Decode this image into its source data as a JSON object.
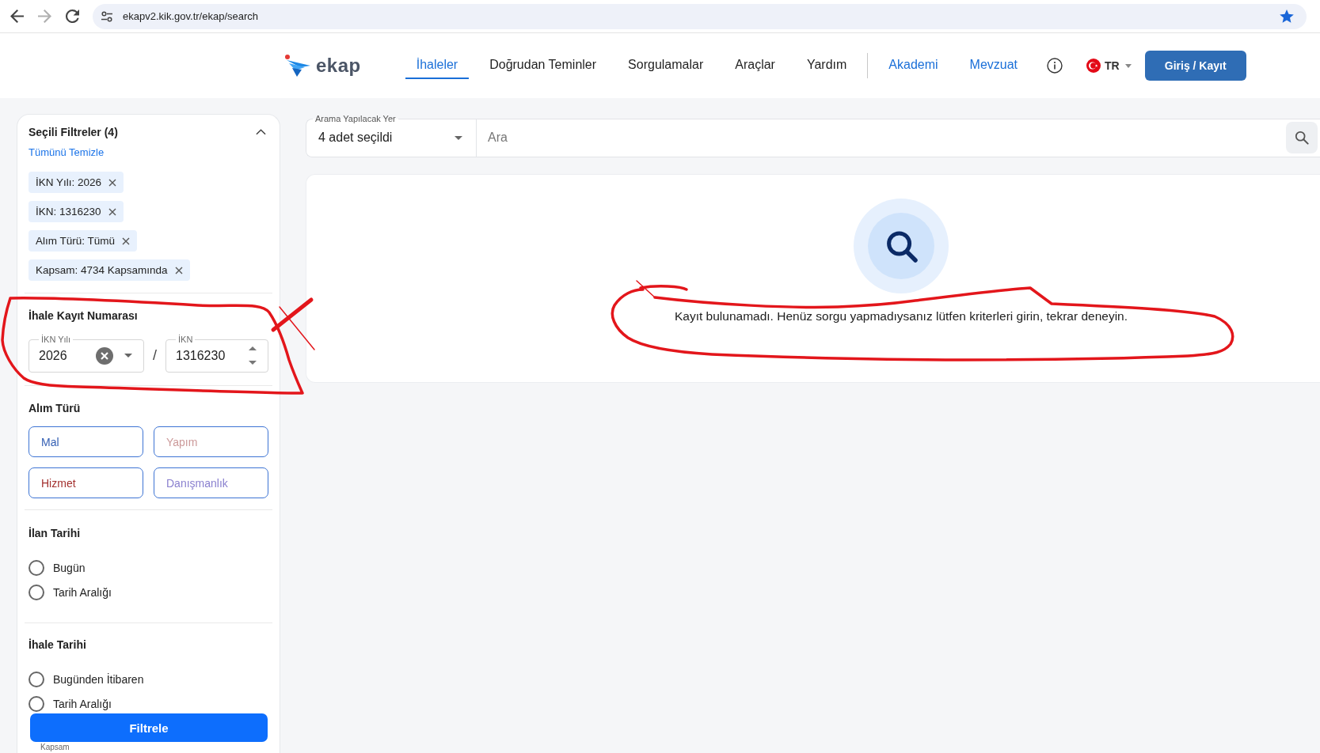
{
  "browser": {
    "url": "ekapv2.kik.gov.tr/ekap/search",
    "can_go_forward": false,
    "bookmarked": true
  },
  "header": {
    "logo_text": "ekap",
    "nav": [
      {
        "label": "İhaleler",
        "kind": "menu",
        "selected": true
      },
      {
        "label": "Doğrudan Teminler",
        "kind": "menu",
        "selected": false
      },
      {
        "label": "Sorgulamalar",
        "kind": "menu",
        "selected": false
      },
      {
        "label": "Araçlar",
        "kind": "menu",
        "selected": false
      },
      {
        "label": "Yardım",
        "kind": "menu",
        "selected": false
      },
      {
        "label": "Akademi",
        "kind": "link",
        "selected": false
      },
      {
        "label": "Mevzuat",
        "kind": "link",
        "selected": false
      }
    ],
    "language": "TR",
    "login_button": "Giriş / Kayıt"
  },
  "sidebar": {
    "selected_filters": {
      "title": "Seçili Filtreler (4)",
      "expanded": true,
      "clear_all": "Tümünü Temizle",
      "chips": [
        "İKN Yılı: 2026",
        "İKN: 1316230",
        "Alım Türü: Tümü",
        "Kapsam: 4734 Kapsamında"
      ]
    },
    "ikn": {
      "title": "İhale Kayıt Numarası",
      "circled": true,
      "year_field": {
        "label": "İKN Yılı",
        "value": "2026"
      },
      "separator": "/",
      "number_field": {
        "label": "İKN",
        "value": "1316230"
      }
    },
    "procurement_type": {
      "title": "Alım Türü",
      "options": [
        {
          "label": "Mal",
          "color": "#3560b4"
        },
        {
          "label": "Yapım",
          "color": "#cc9a9a"
        },
        {
          "label": "Hizmet",
          "color": "#a3312f"
        },
        {
          "label": "Danışmanlık",
          "color": "#8a80cf"
        }
      ]
    },
    "announcement_date": {
      "title": "İlan Tarihi",
      "options": [
        {
          "label": "Bugün",
          "selected": false
        },
        {
          "label": "Tarih Aralığı",
          "selected": false
        }
      ]
    },
    "tender_date": {
      "title": "İhale Tarihi",
      "options": [
        {
          "label": "Bugünden İtibaren",
          "selected": false
        },
        {
          "label": "Tarih Aralığı",
          "selected": false
        }
      ]
    },
    "filter_button": "Filtrele",
    "scope_field": {
      "label": "Kapsam"
    }
  },
  "main": {
    "search": {
      "scope_label": "Arama Yapılacak Yer",
      "scope_value": "4 adet seçildi",
      "placeholder": "Ara"
    },
    "results": {
      "message": "Kayıt bulunamadı. Henüz sorgu yapmadıysanız lütfen kriterleri girin, tekrar deneyin.",
      "circled": true
    }
  }
}
